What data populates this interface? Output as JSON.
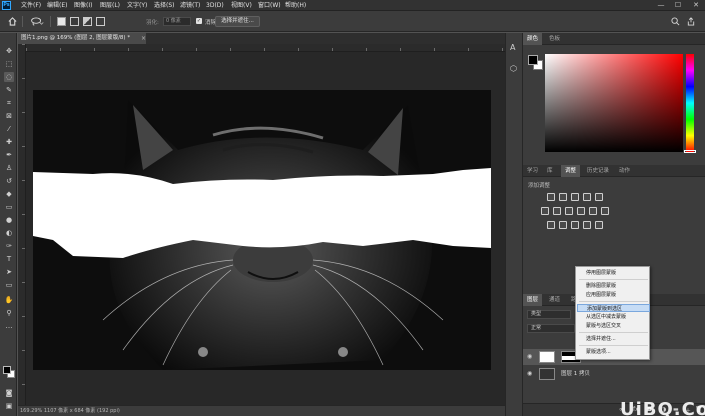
{
  "app": {
    "icon_text": "Ps"
  },
  "menu": [
    "文件(F)",
    "编辑(E)",
    "图像(I)",
    "图层(L)",
    "文字(Y)",
    "选择(S)",
    "滤镜(T)",
    "3D(D)",
    "视图(V)",
    "窗口(W)",
    "帮助(H)"
  ],
  "window_controls": [
    "—",
    "☐",
    "✕"
  ],
  "options": {
    "feather_label": "羽化:",
    "feather_value": "0 像素",
    "antialias_label": "消除锯齿",
    "select_mask_label": "选择并遮住..."
  },
  "document": {
    "tab_title": "图片1.png @ 169% (图层 2, 图层蒙版/8) *",
    "tab_close": "×",
    "status": "169.29%   1107 像素 x 684 像素 (192 ppi)"
  },
  "panels": {
    "color_tabs": [
      "颜色",
      "色板"
    ],
    "adjust_tabs": [
      "学习",
      "库",
      "调整",
      "历史记录",
      "动作"
    ],
    "adjust_active": "调整",
    "adjust_label": "添加调整",
    "layer_tabs": [
      "图层",
      "通道",
      "路径"
    ],
    "layer_active": "图层",
    "filter_kind": "类型",
    "blend_mode": "正常"
  },
  "layers": [
    {
      "name": "图层 2",
      "visible": true
    },
    {
      "name": "图层 1 拷贝",
      "visible": true
    }
  ],
  "context_menu": {
    "items": [
      {
        "label": "停用图层蒙版",
        "highlighted": false
      },
      {
        "label": "删除图层蒙版",
        "highlighted": false
      },
      {
        "label": "应用图层蒙版",
        "highlighted": false
      },
      {
        "label": "添加蒙版到选区",
        "highlighted": true
      },
      {
        "label": "从选区中减去蒙版",
        "highlighted": false
      },
      {
        "label": "蒙版与选区交叉",
        "highlighted": false
      },
      {
        "label": "选择并遮住...",
        "highlighted": false
      },
      {
        "label": "蒙版选项...",
        "highlighted": false
      }
    ]
  },
  "watermark": "UiBQ.CoM"
}
